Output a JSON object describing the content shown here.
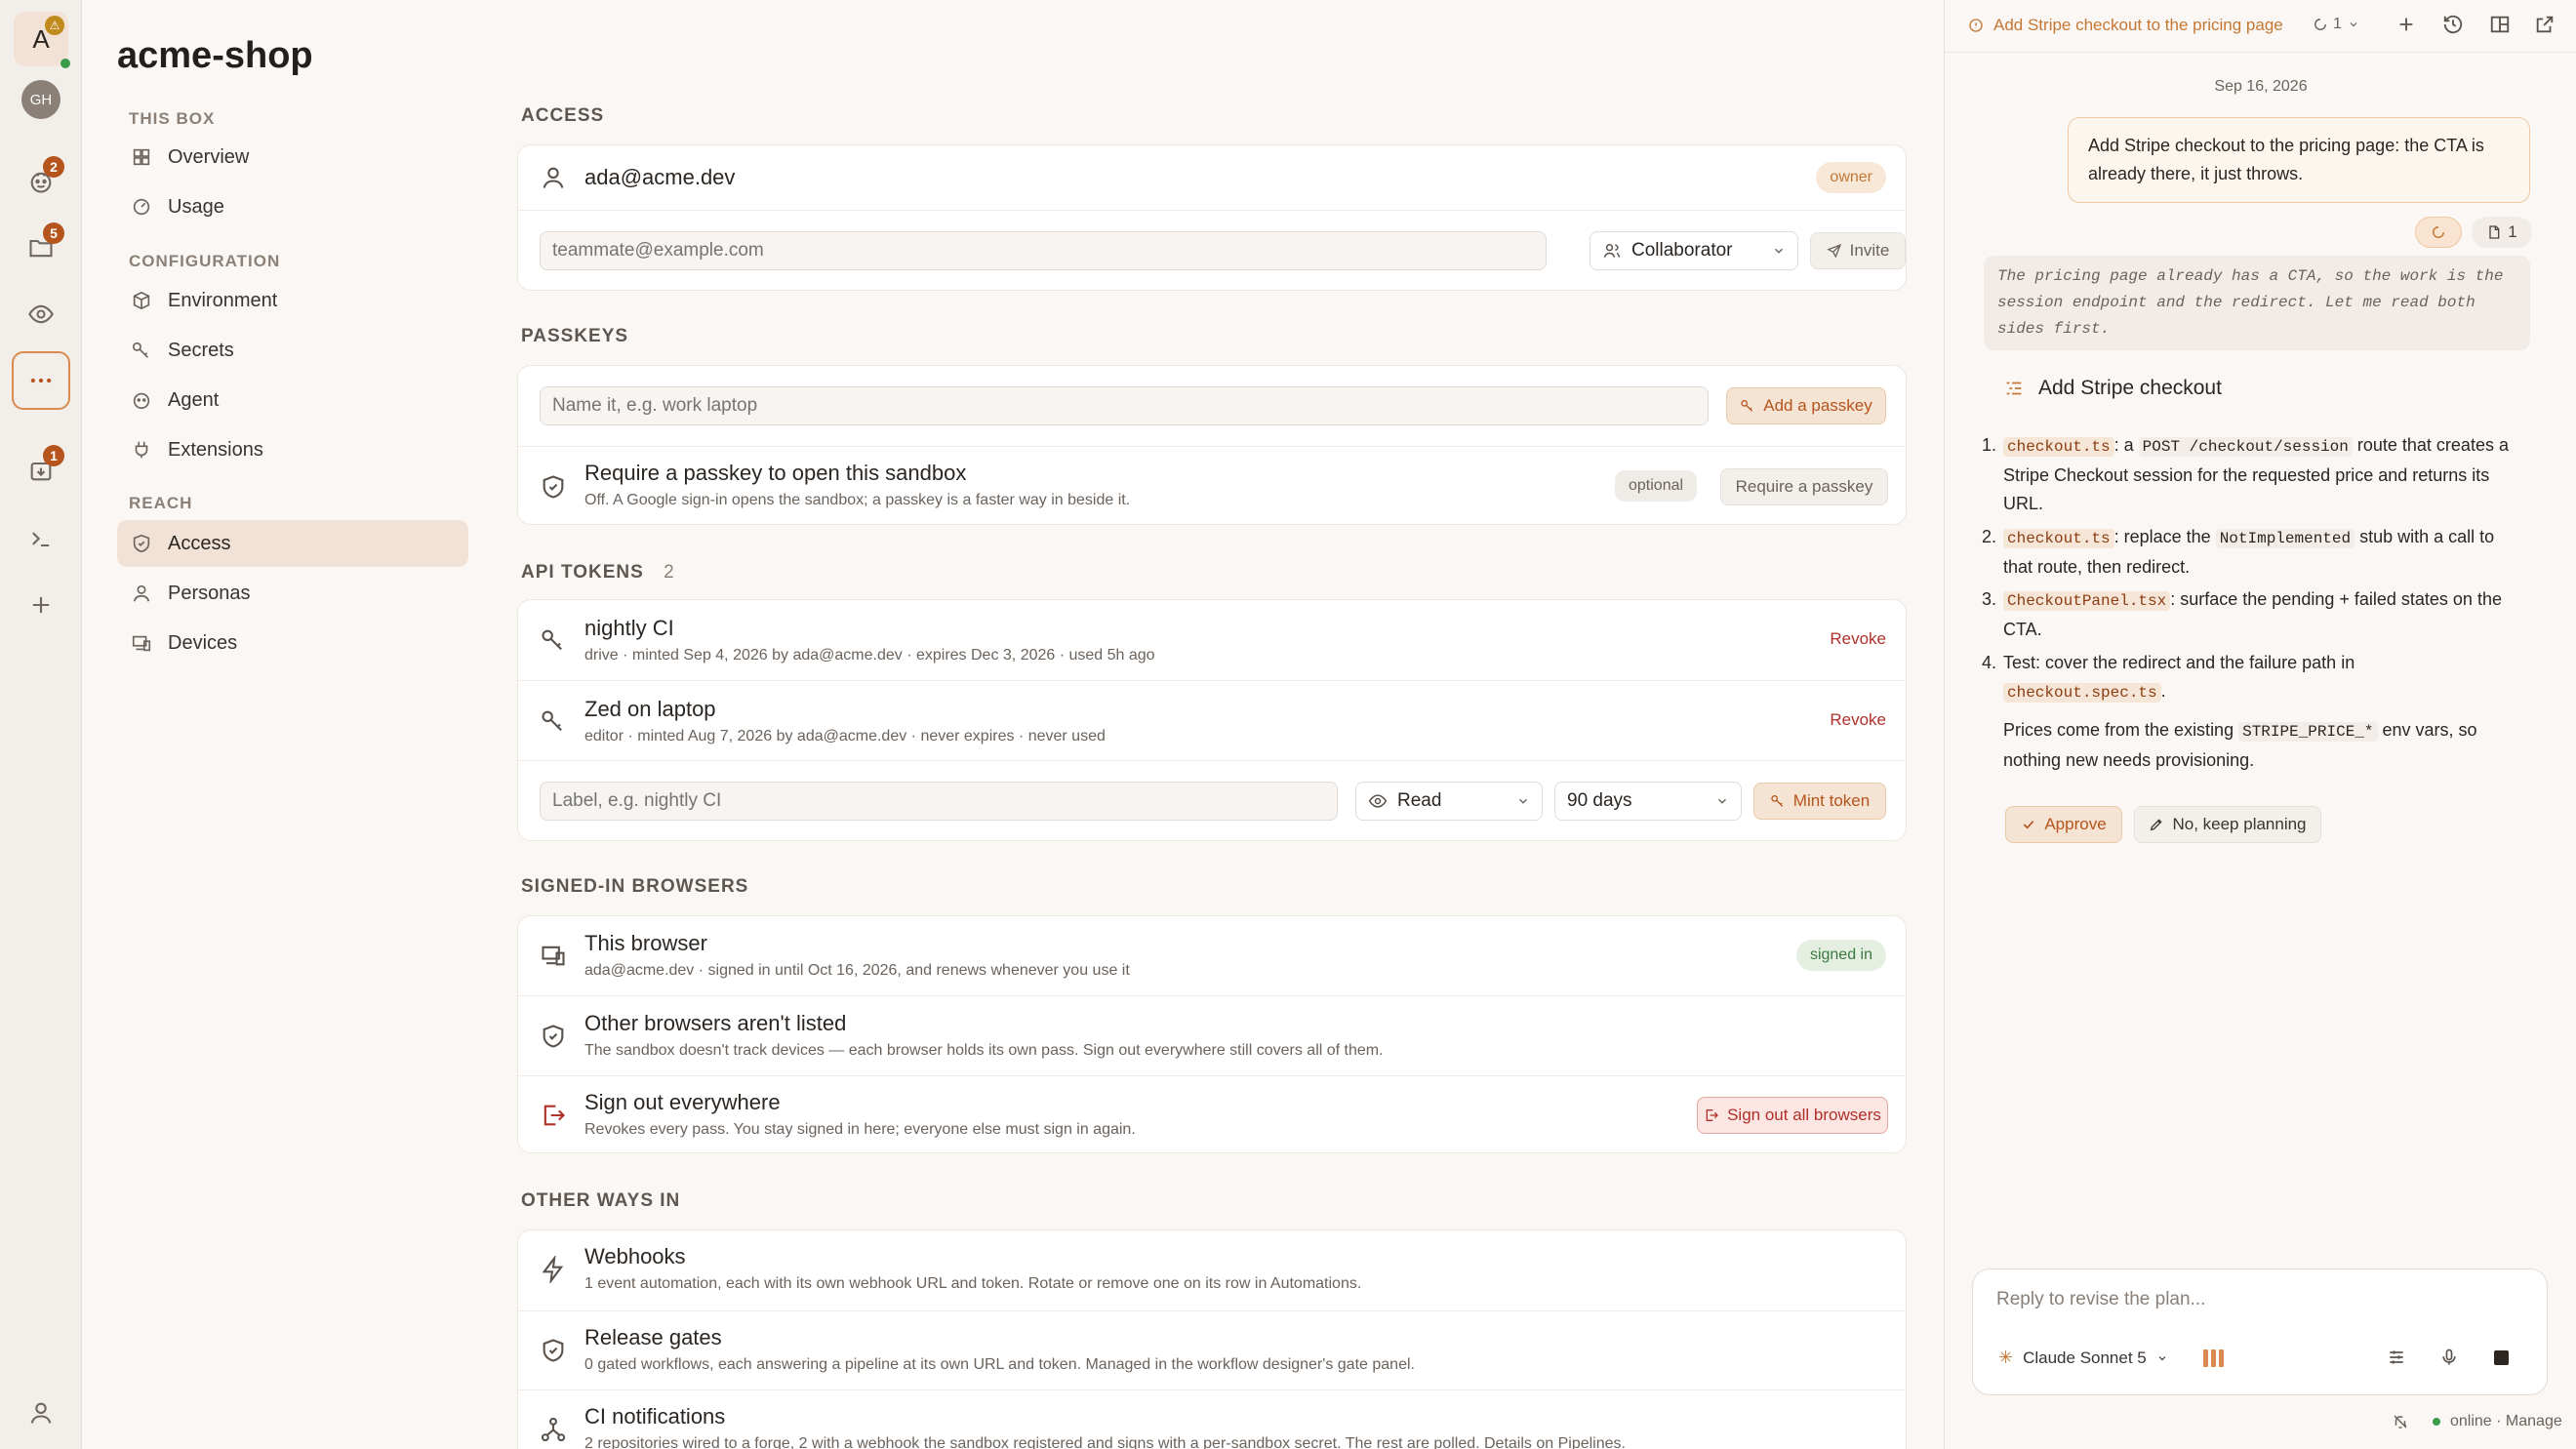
{
  "rail": {
    "avatar_letter": "A",
    "gh_label": "GH",
    "badges": {
      "agent": "2",
      "files": "5",
      "deploys": "1"
    }
  },
  "nav": {
    "brand": "acme-shop",
    "sections": [
      {
        "title": "THIS BOX",
        "items": [
          "Overview",
          "Usage"
        ]
      },
      {
        "title": "CONFIGURATION",
        "items": [
          "Environment",
          "Secrets",
          "Agent",
          "Extensions"
        ]
      },
      {
        "title": "REACH",
        "items": [
          "Access",
          "Personas",
          "Devices"
        ]
      }
    ],
    "active": "Access"
  },
  "access": {
    "title": "ACCESS",
    "user": "ada@acme.dev",
    "role_badge": "owner",
    "invite_placeholder": "teammate@example.com",
    "role_select": "Collaborator",
    "invite_label": "Invite"
  },
  "passkeys": {
    "title": "PASSKEYS",
    "name_placeholder": "Name it, e.g. work laptop",
    "add_label": "Add a passkey",
    "require_title": "Require a passkey to open this sandbox",
    "require_sub": "Off. A Google sign-in opens the sandbox; a passkey is a faster way in beside it.",
    "optional_label": "optional",
    "require_button": "Require a passkey"
  },
  "tokens": {
    "title": "API TOKENS",
    "count": "2",
    "items": [
      {
        "name": "nightly CI",
        "meta": "drive · minted Sep 4, 2026 by ada@acme.dev · expires Dec 3, 2026 · used 5h ago",
        "action": "Revoke"
      },
      {
        "name": "Zed on laptop",
        "meta": "editor · minted Aug 7, 2026 by ada@acme.dev · never expires · never used",
        "action": "Revoke"
      }
    ],
    "label_placeholder": "Label, e.g. nightly CI",
    "scope_select": "Read",
    "expiry_select": "90 days",
    "mint_label": "Mint token"
  },
  "browsers": {
    "title": "SIGNED-IN BROWSERS",
    "this_title": "This browser",
    "this_sub": "ada@acme.dev · signed in until Oct 16, 2026, and renews whenever you use it",
    "signed_in_badge": "signed in",
    "other_title": "Other browsers aren't listed",
    "other_sub": "The sandbox doesn't track devices — each browser holds its own pass. Sign out everywhere still covers all of them.",
    "signout_title": "Sign out everywhere",
    "signout_sub": "Revokes every pass. You stay signed in here; everyone else must sign in again.",
    "signout_button": "Sign out all browsers"
  },
  "other_ways": {
    "title": "OTHER WAYS IN",
    "items": [
      {
        "title": "Webhooks",
        "sub": "1 event automation, each with its own webhook URL and token. Rotate or remove one on its row in Automations."
      },
      {
        "title": "Release gates",
        "sub": "0 gated workflows, each answering a pipeline at its own URL and token. Managed in the workflow designer's gate panel."
      },
      {
        "title": "CI notifications",
        "sub": "2 repositories wired to a forge, 2 with a webhook the sandbox registered and signs with a per-sandbox secret. The rest are polled. Details on Pipelines."
      }
    ]
  },
  "chat": {
    "tab_title": "Add Stripe checkout to the pricing page",
    "tab_count": "1",
    "date": "Sep 16, 2026",
    "user_message": "Add Stripe checkout to the pricing page: the CTA is already there, it just throws.",
    "files_count": "1",
    "thinking": "The pricing page already has a CTA, so the work is the session endpoint and the redirect. Let me read both sides first.",
    "plan_title": "Add Stripe checkout",
    "steps": [
      {
        "n": "1.",
        "code": "checkout.ts",
        "text_a": ": a ",
        "code2": "POST /checkout/session",
        "text_b": " route that creates a Stripe Checkout session for the requested price and returns its URL."
      },
      {
        "n": "2.",
        "code": "checkout.ts",
        "text_a": ": replace the ",
        "code2": "NotImplemented",
        "text_b": " stub with a call to that route, then redirect."
      },
      {
        "n": "3.",
        "code": "CheckoutPanel.tsx",
        "text_a": ": surface the pending + failed states on the CTA.",
        "code2": "",
        "text_b": ""
      },
      {
        "n": "4.",
        "lead": "Test: cover the redirect and the failure path in",
        "code": "checkout.spec.ts",
        "tail": "."
      }
    ],
    "footer_a": "Prices come from the existing ",
    "footer_code": "STRIPE_PRICE_*",
    "footer_b": " env vars, so nothing new needs provisioning.",
    "approve_label": "Approve",
    "keep_planning_label": "No, keep planning",
    "reply_placeholder": "Reply to revise the plan...",
    "model": "Claude Sonnet 5",
    "status": "online · Manage"
  }
}
